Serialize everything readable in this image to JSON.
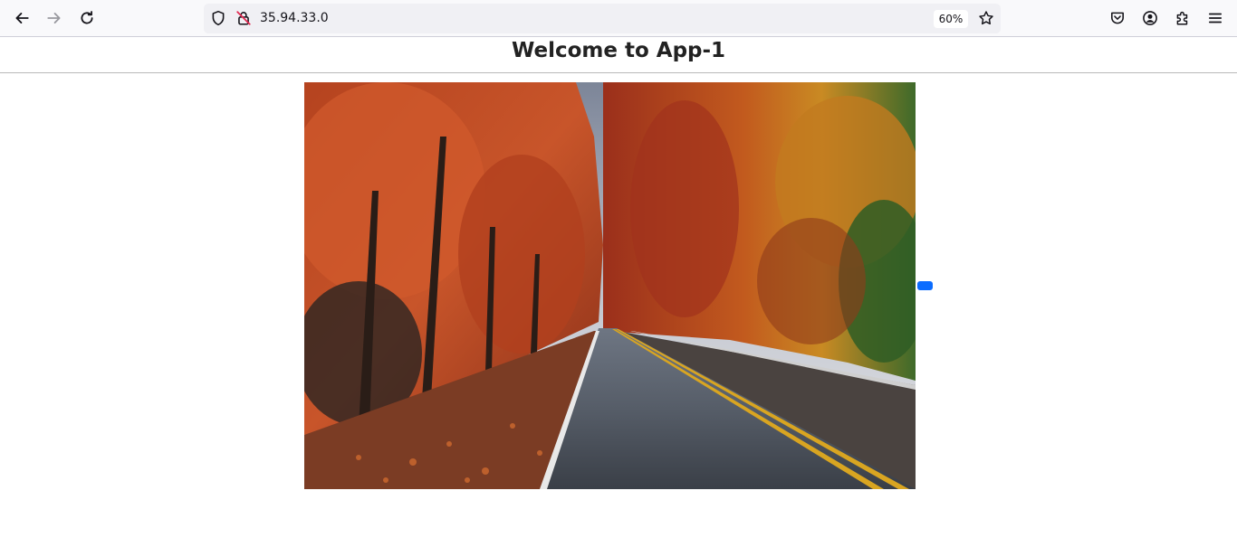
{
  "browser": {
    "url": "35.94.33.0",
    "zoom": "60%",
    "icons": {
      "back": "arrow-left-icon",
      "forward": "arrow-right-icon",
      "reload": "reload-icon",
      "shield": "tracking-shield-icon",
      "insecure": "insecure-lock-icon",
      "bookmark": "star-icon",
      "pocket": "pocket-icon",
      "account": "account-icon",
      "extensions": "puzzle-icon",
      "menu": "hamburger-menu-icon"
    }
  },
  "page": {
    "title": "Welcome to App-1",
    "image_subject": "autumn-road-photo"
  },
  "colors": {
    "accent": "#0b6cff",
    "toolbar": "#f9f9fb",
    "urlbar": "#f0f0f4"
  }
}
